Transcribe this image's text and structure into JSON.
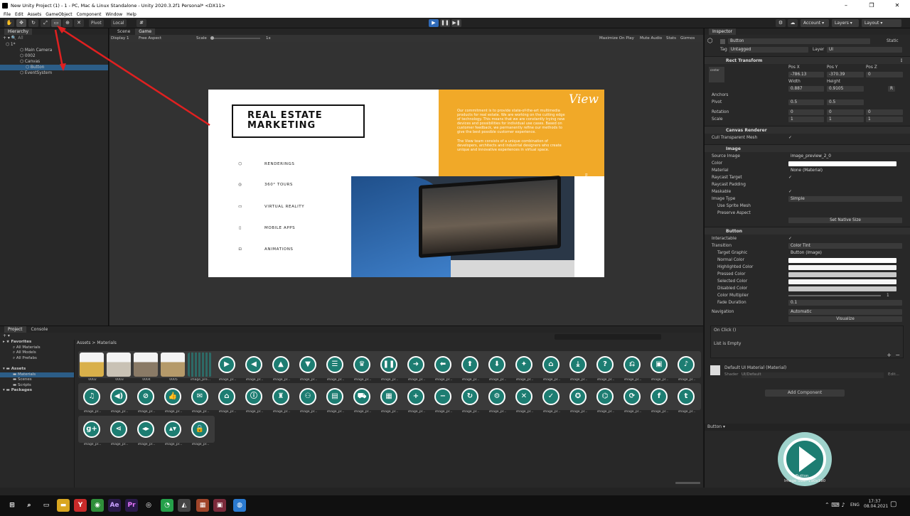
{
  "titlebar": {
    "title": "New Unity Project (1) - 1 - PC, Mac & Linux Standalone - Unity 2020.3.2f1 Personal* <DX11>",
    "min": "–",
    "max": "❐",
    "close": "✕"
  },
  "menu": [
    "File",
    "Edit",
    "Assets",
    "GameObject",
    "Component",
    "Window",
    "Help"
  ],
  "toolbar": {
    "pivot": "Pivot",
    "local": "Local",
    "account": "Account",
    "layers": "Layers",
    "layout": "Layout"
  },
  "hierarchy": {
    "tab": "Hierarchy",
    "search_placeholder": "All",
    "rows": [
      {
        "label": "1*",
        "indent": 8
      },
      {
        "label": "Main Camera",
        "indent": 28
      },
      {
        "label": "0002",
        "indent": 28
      },
      {
        "label": "Canvas",
        "indent": 28
      },
      {
        "label": "Button",
        "indent": 36,
        "selected": true
      },
      {
        "label": "EventSystem",
        "indent": 28
      }
    ]
  },
  "scene_tabs": [
    "Scene",
    "Game"
  ],
  "gamebar": {
    "display": "Display 1",
    "aspect": "Free Aspect",
    "scale_label": "Scale",
    "scale_value": "1x",
    "maximize": "Maximize On Play",
    "mute": "Mute Audio",
    "stats": "Stats",
    "gizmos": "Gizmos"
  },
  "slide": {
    "heading_line1": "REAL ESTATE",
    "heading_line2": "MARKETING",
    "services": [
      "RENDERINGS",
      "360° TOURS",
      "VIRTUAL REALITY",
      "MOBILE APPS",
      "ANIMATIONS"
    ],
    "logo": "View",
    "paragraph1": "Our commitment is to provide state-of-the-art multimedia products for real estate. We are working on the cutting edge of technology. This means that we are constantly trying new devices and possibilities for individual use cases. Based on customer feedback, we permanently refine our methods to give the best possible customer experience.",
    "paragraph2": "The View team consists of a unique combination of developers, architects and industrial designers who create unique and innovative experiences in virtual space.",
    "vertical": "the view"
  },
  "project": {
    "tabs": [
      "Project",
      "Console"
    ],
    "breadcrumb": "Assets > Materials",
    "tree": [
      {
        "label": "Favorites",
        "bold": true,
        "indent": 4
      },
      {
        "label": "All Materials",
        "indent": 18
      },
      {
        "label": "All Models",
        "indent": 18
      },
      {
        "label": "All Prefabs",
        "indent": 18
      },
      {
        "label": "",
        "indent": 0
      },
      {
        "label": "Assets",
        "bold": true,
        "indent": 4
      },
      {
        "label": "Materials",
        "indent": 18,
        "selected": true
      },
      {
        "label": "Scenes",
        "indent": 18
      },
      {
        "label": "Scripts",
        "indent": 18
      },
      {
        "label": "Packages",
        "bold": true,
        "indent": 4
      }
    ],
    "row1": [
      {
        "cap": "0002",
        "type": "img",
        "c": "#d9b04a"
      },
      {
        "cap": "0003",
        "type": "img",
        "c": "#c9c2b5"
      },
      {
        "cap": "0004",
        "type": "img",
        "c": "#8a7a66"
      },
      {
        "cap": "0005",
        "type": "img",
        "c": "#b59a6a"
      },
      {
        "cap": "image_pre...",
        "type": "grid"
      },
      {
        "cap": "image_pr...",
        "g": "▶"
      },
      {
        "cap": "image_pr...",
        "g": "◀"
      },
      {
        "cap": "image_pr...",
        "g": "▲"
      },
      {
        "cap": "image_pr...",
        "g": "▼"
      },
      {
        "cap": "image_pr...",
        "g": "☰"
      },
      {
        "cap": "image_pr...",
        "g": "♛"
      },
      {
        "cap": "image_pr...",
        "g": "❚❚"
      },
      {
        "cap": "image_pr...",
        "g": "➜"
      },
      {
        "cap": "image_pr...",
        "g": "⬅"
      },
      {
        "cap": "image_pr...",
        "g": "⬆"
      },
      {
        "cap": "image_pr...",
        "g": "⬇"
      },
      {
        "cap": "image_pr...",
        "g": "✦"
      },
      {
        "cap": "image_pr...",
        "g": "⌂"
      },
      {
        "cap": "image_pr...",
        "g": "⤓"
      },
      {
        "cap": "image_pr...",
        "g": "?"
      },
      {
        "cap": "image_pr...",
        "g": "⎌"
      },
      {
        "cap": "image_pr...",
        "g": "▣"
      },
      {
        "cap": "image_pr...",
        "g": "♪"
      }
    ],
    "row2": [
      {
        "cap": "image_pr...",
        "g": "♫"
      },
      {
        "cap": "image_pr...",
        "g": "◀)"
      },
      {
        "cap": "image_pr...",
        "g": "⊘"
      },
      {
        "cap": "image_pr...",
        "g": "👍"
      },
      {
        "cap": "image_pr...",
        "g": "✉"
      },
      {
        "cap": "image_pr...",
        "g": "⌂"
      },
      {
        "cap": "image_pr...",
        "g": "ⓘ"
      },
      {
        "cap": "image_pr...",
        "g": "♜"
      },
      {
        "cap": "image_pr...",
        "g": "⚇"
      },
      {
        "cap": "image_pr...",
        "g": "▤"
      },
      {
        "cap": "image_pr...",
        "g": "⛟"
      },
      {
        "cap": "image_pr...",
        "g": "▦"
      },
      {
        "cap": "image_pr...",
        "g": "+"
      },
      {
        "cap": "image_pr...",
        "g": "−"
      },
      {
        "cap": "image_pr...",
        "g": "↻"
      },
      {
        "cap": "image_pr...",
        "g": "⚙"
      },
      {
        "cap": "image_pr...",
        "g": "✕"
      },
      {
        "cap": "image_pr...",
        "g": "✓"
      },
      {
        "cap": "image_pr...",
        "g": "✪"
      },
      {
        "cap": "image_pr...",
        "g": "⌬"
      },
      {
        "cap": "image_pr...",
        "g": "⟳"
      },
      {
        "cap": "image_pr...",
        "g": "f"
      },
      {
        "cap": "image_pr...",
        "g": "t"
      }
    ],
    "row3": [
      {
        "cap": "image_pr...",
        "g": "g+"
      },
      {
        "cap": "image_pr...",
        "g": "⋖"
      },
      {
        "cap": "image_pr...",
        "g": "◂▸"
      },
      {
        "cap": "image_pr...",
        "g": "▴▾"
      },
      {
        "cap": "image_pr...",
        "g": "🔒"
      }
    ]
  },
  "inspector": {
    "tab": "Inspector",
    "object_name": "Button",
    "static": "Static",
    "tag_label": "Tag",
    "tag": "Untagged",
    "layer_label": "Layer",
    "layer": "UI",
    "rect": {
      "title": "Rect Transform",
      "center": "center",
      "middle": "middle",
      "posx_l": "Pos X",
      "posy_l": "Pos Y",
      "posz_l": "Pos Z",
      "posx": "-786.13",
      "posy": "-370.39",
      "posz": "0",
      "w_l": "Width",
      "h_l": "Height",
      "w": "0.887",
      "h": "0.9105",
      "anchors": "Anchors",
      "pivot": "Pivot",
      "pivx": "0.5",
      "pivy": "0.5",
      "rotation": "Rotation",
      "rx": "0",
      "ry": "0",
      "rz": "0",
      "scale": "Scale",
      "sx": "1",
      "sy": "1",
      "sz": "1",
      "r_btn": "R"
    },
    "canvas_renderer": {
      "title": "Canvas Renderer",
      "cull": "Cull Transparent Mesh"
    },
    "image": {
      "title": "Image",
      "source": "Source Image",
      "source_v": "image_preview_2_0",
      "color": "Color",
      "material": "Material",
      "material_v": "None (Material)",
      "raycast": "Raycast Target",
      "padding": "Raycast Padding",
      "maskable": "Maskable",
      "type": "Image Type",
      "type_v": "Simple",
      "sprite_mesh": "Use Sprite Mesh",
      "preserve": "Preserve Aspect",
      "native": "Set Native Size"
    },
    "button": {
      "title": "Button",
      "interactable": "Interactable",
      "transition": "Transition",
      "transition_v": "Color Tint",
      "target": "Target Graphic",
      "target_v": "Button (Image)",
      "normal": "Normal Color",
      "highlighted": "Highlighted Color",
      "pressed": "Pressed Color",
      "selected": "Selected Color",
      "disabled": "Disabled Color",
      "multiplier": "Color Multiplier",
      "multiplier_v": "1",
      "fade": "Fade Duration",
      "fade_v": "0.1",
      "navigation": "Navigation",
      "navigation_v": "Automatic",
      "visualize": "Visualize",
      "onclick": "On Click ()",
      "empty": "List is Empty"
    },
    "material": {
      "name": "Default UI Material (Material)",
      "shader_l": "Shader",
      "shader": "UI/Default",
      "edit": "Edit..."
    },
    "add_component": "Add Component",
    "preview_title": "Button",
    "preview_caption1": "Button",
    "preview_caption2": "Image Size: 190x190"
  },
  "taskbar": {
    "lang": "ENG",
    "time": "17:37",
    "date": "08.04.2021"
  },
  "colors": {
    "accent": "#2c5d87",
    "play": "#2f6ab8",
    "orange": "#f1a928",
    "teal": "#1d7d72"
  }
}
